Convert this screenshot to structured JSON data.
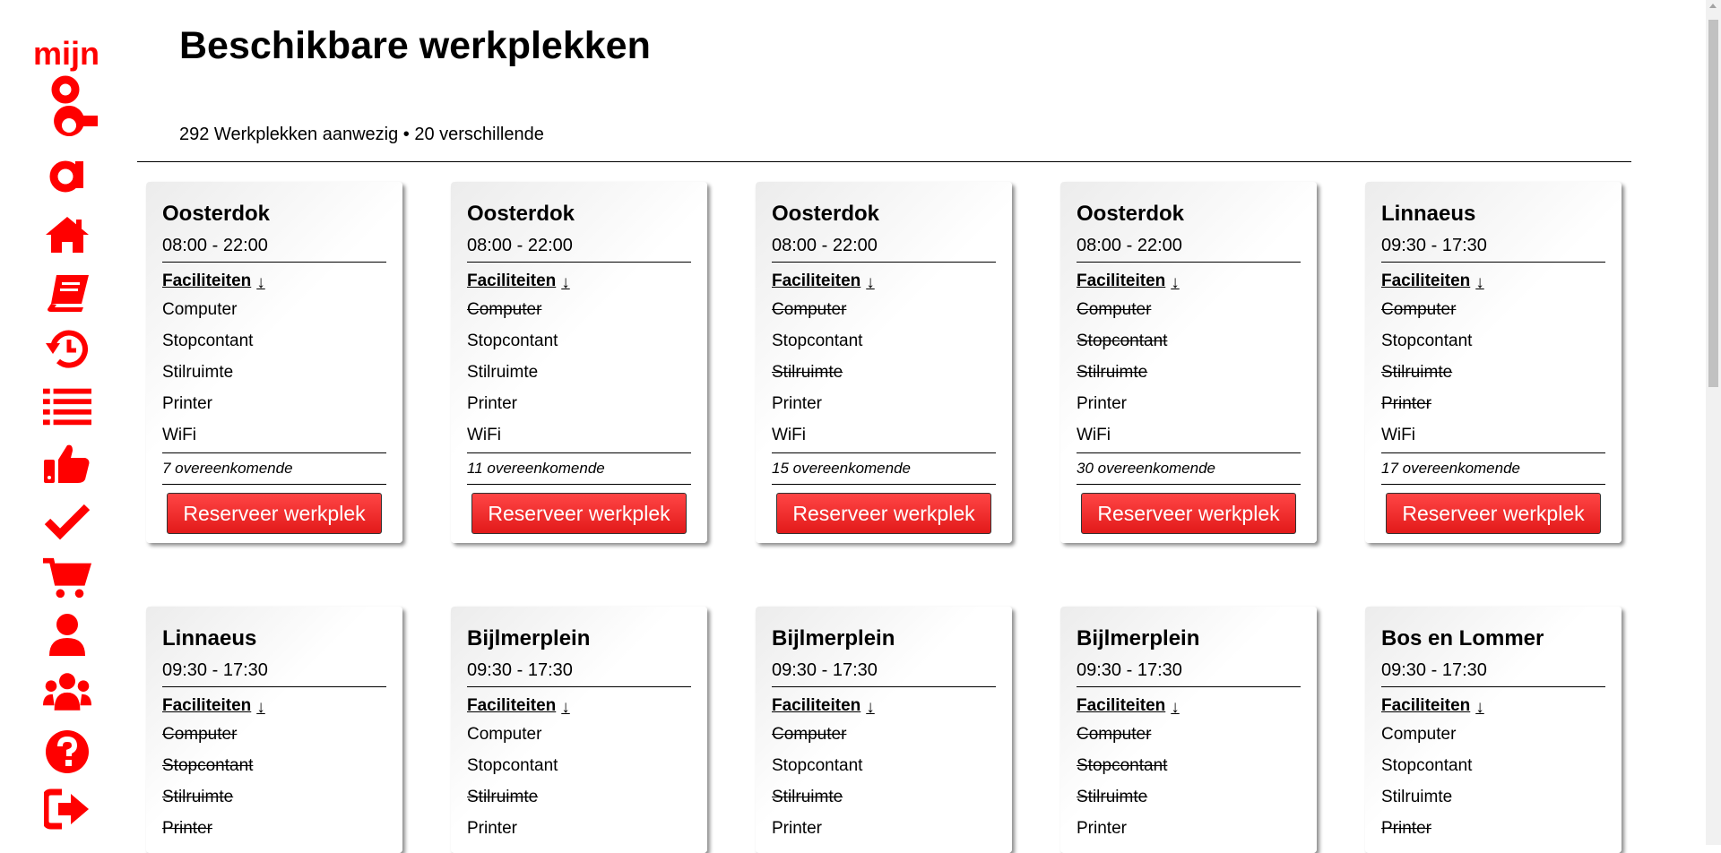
{
  "brand": {
    "word": "mijn",
    "letters": "oba",
    "color": "#ff0000"
  },
  "nav": [
    "home-icon",
    "book-icon",
    "history-icon",
    "list-icon",
    "thumbs-up-icon",
    "check-icon",
    "cart-icon",
    "user-icon",
    "users-icon",
    "help-icon",
    "sign-out-icon"
  ],
  "page": {
    "title": "Beschikbare werkplekken",
    "summary": "292 Werkplekken aanwezig • 20 verschillende"
  },
  "labels": {
    "facilities": "Faciliteiten",
    "arrow": "↓",
    "reserve": "Reserveer werkplek"
  },
  "cards": [
    {
      "location": "Oosterdok",
      "hours": "08:00 - 22:00",
      "facilities": [
        {
          "name": "Computer",
          "available": true
        },
        {
          "name": "Stopcontant",
          "available": true
        },
        {
          "name": "Stilruimte",
          "available": true
        },
        {
          "name": "Printer",
          "available": true
        },
        {
          "name": "WiFi",
          "available": true
        }
      ],
      "matches": "7 overeenkomende"
    },
    {
      "location": "Oosterdok",
      "hours": "08:00 - 22:00",
      "facilities": [
        {
          "name": "Computer",
          "available": false
        },
        {
          "name": "Stopcontant",
          "available": true
        },
        {
          "name": "Stilruimte",
          "available": true
        },
        {
          "name": "Printer",
          "available": true
        },
        {
          "name": "WiFi",
          "available": true
        }
      ],
      "matches": "11 overeenkomende"
    },
    {
      "location": "Oosterdok",
      "hours": "08:00 - 22:00",
      "facilities": [
        {
          "name": "Computer",
          "available": false
        },
        {
          "name": "Stopcontant",
          "available": true
        },
        {
          "name": "Stilruimte",
          "available": false
        },
        {
          "name": "Printer",
          "available": true
        },
        {
          "name": "WiFi",
          "available": true
        }
      ],
      "matches": "15 overeenkomende"
    },
    {
      "location": "Oosterdok",
      "hours": "08:00 - 22:00",
      "facilities": [
        {
          "name": "Computer",
          "available": false
        },
        {
          "name": "Stopcontant",
          "available": false
        },
        {
          "name": "Stilruimte",
          "available": false
        },
        {
          "name": "Printer",
          "available": true
        },
        {
          "name": "WiFi",
          "available": true
        }
      ],
      "matches": "30 overeenkomende"
    },
    {
      "location": "Linnaeus",
      "hours": "09:30 - 17:30",
      "facilities": [
        {
          "name": "Computer",
          "available": false
        },
        {
          "name": "Stopcontant",
          "available": true
        },
        {
          "name": "Stilruimte",
          "available": false
        },
        {
          "name": "Printer",
          "available": false
        },
        {
          "name": "WiFi",
          "available": true
        }
      ],
      "matches": "17 overeenkomende"
    },
    {
      "location": "Linnaeus",
      "hours": "09:30 - 17:30",
      "facilities": [
        {
          "name": "Computer",
          "available": false
        },
        {
          "name": "Stopcontant",
          "available": false
        },
        {
          "name": "Stilruimte",
          "available": false
        },
        {
          "name": "Printer",
          "available": false
        }
      ]
    },
    {
      "location": "Bijlmerplein",
      "hours": "09:30 - 17:30",
      "facilities": [
        {
          "name": "Computer",
          "available": true
        },
        {
          "name": "Stopcontant",
          "available": true
        },
        {
          "name": "Stilruimte",
          "available": false
        },
        {
          "name": "Printer",
          "available": true
        }
      ]
    },
    {
      "location": "Bijlmerplein",
      "hours": "09:30 - 17:30",
      "facilities": [
        {
          "name": "Computer",
          "available": false
        },
        {
          "name": "Stopcontant",
          "available": true
        },
        {
          "name": "Stilruimte",
          "available": false
        },
        {
          "name": "Printer",
          "available": true
        }
      ]
    },
    {
      "location": "Bijlmerplein",
      "hours": "09:30 - 17:30",
      "facilities": [
        {
          "name": "Computer",
          "available": false
        },
        {
          "name": "Stopcontant",
          "available": false
        },
        {
          "name": "Stilruimte",
          "available": false
        },
        {
          "name": "Printer",
          "available": true
        }
      ]
    },
    {
      "location": "Bos en Lommer",
      "hours": "09:30 - 17:30",
      "facilities": [
        {
          "name": "Computer",
          "available": true
        },
        {
          "name": "Stopcontant",
          "available": true
        },
        {
          "name": "Stilruimte",
          "available": true
        },
        {
          "name": "Printer",
          "available": false
        }
      ]
    }
  ]
}
